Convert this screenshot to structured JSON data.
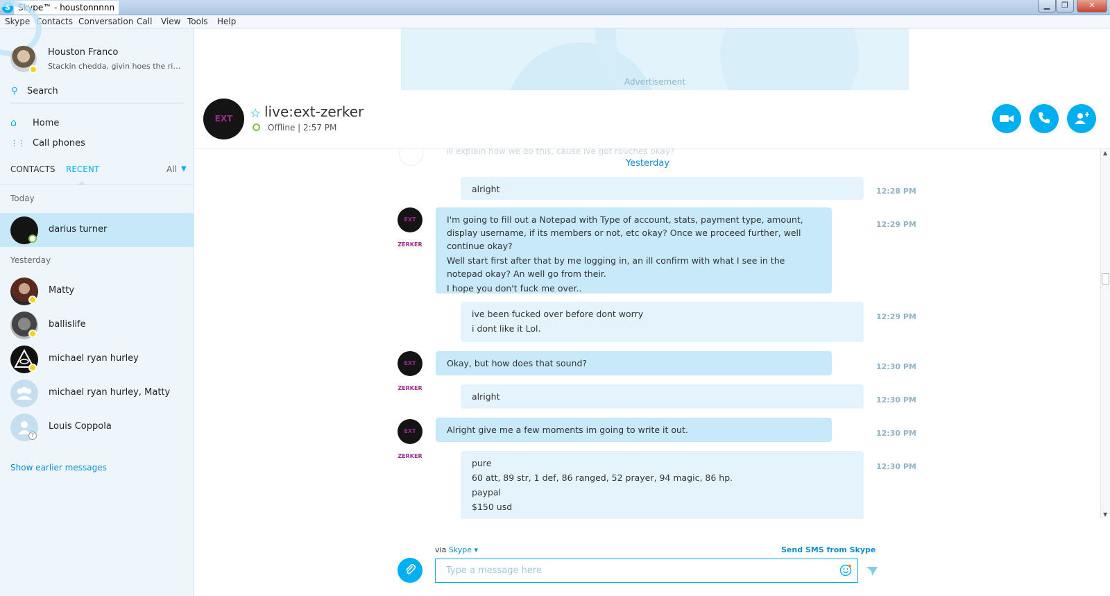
{
  "window": {
    "title": "Skype™ - houstonnnnn",
    "controls": {
      "minimize": "▁",
      "maximize": "❐",
      "close": "✕"
    }
  },
  "menu": [
    "Skype",
    "Contacts",
    "Conversation",
    "Call",
    "View",
    "Tools",
    "Help"
  ],
  "profile": {
    "name": "Houston Franco",
    "mood": "Stackin chedda, givin hoes the righ...",
    "status": "away"
  },
  "sidebar": {
    "search_label": "Search",
    "nav": [
      {
        "label": "Home",
        "icon": "home-icon"
      },
      {
        "label": "Call phones",
        "icon": "dialpad-icon"
      }
    ],
    "tabs": {
      "contacts": "CONTACTS",
      "recent": "RECENT",
      "filter": "All",
      "active": "recent"
    },
    "sections": [
      {
        "label": "Today",
        "contacts": [
          {
            "name": "darius turner",
            "status": "online",
            "selected": true
          }
        ]
      },
      {
        "label": "Yesterday",
        "contacts": [
          {
            "name": "Matty",
            "status": "away"
          },
          {
            "name": "ballislife",
            "status": "away"
          },
          {
            "name": "michael ryan hurley",
            "status": "away"
          },
          {
            "name": "michael ryan hurley, Matty",
            "status": "group"
          },
          {
            "name": "Louis Coppola",
            "status": "unknown"
          }
        ]
      }
    ],
    "show_earlier": "Show earlier messages"
  },
  "ad": {
    "label": "Advertisement"
  },
  "conversation": {
    "name": "live:ext-zerker",
    "avatar_text": "EXT ZERKER",
    "status": "Offline | 2:57 PM",
    "faded_message": "ill explain how we do this, cause ive got rouches okay?",
    "day_separator": "Yesterday",
    "messages": [
      {
        "from": "me",
        "lines": [
          "alright"
        ],
        "time": "12:28 PM"
      },
      {
        "from": "them",
        "lines": [
          "I'm going to fill out a Notepad with Type of account, stats, payment type, amount, display username, if its members or not, etc okay? Once we proceed further, well continue okay?",
          "Well start first after that by me logging in, an ill confirm with what I see in the notepad okay? An well go from their.",
          "I hope you don't fuck me over.."
        ],
        "time": "12:29 PM"
      },
      {
        "from": "me",
        "lines": [
          "ive been fucked over before dont worry",
          "i dont like it Lol."
        ],
        "time": "12:29 PM"
      },
      {
        "from": "them",
        "lines": [
          "Okay, but how does that sound?"
        ],
        "time": "12:30 PM"
      },
      {
        "from": "me",
        "lines": [
          "alright"
        ],
        "time": "12:30 PM"
      },
      {
        "from": "them",
        "lines": [
          "Alright give me a few moments im going to write it out."
        ],
        "time": "12:30 PM"
      },
      {
        "from": "me",
        "lines": [
          "pure",
          "60 att, 89 str, 1 def, 86 ranged, 52 prayer, 94 magic, 86 hp.",
          "paypal",
          "$150 usd"
        ],
        "time": "12:30 PM"
      }
    ]
  },
  "compose": {
    "via_label": "via",
    "via_service": "Skype",
    "sms_link": "Send SMS from Skype",
    "placeholder": "Type a message here"
  },
  "colors": {
    "accent": "#00aff0",
    "bubble_me": "#e5f4fc",
    "bubble_them": "#c7e9fa",
    "away": "#fcd116",
    "online": "#7dc242"
  }
}
